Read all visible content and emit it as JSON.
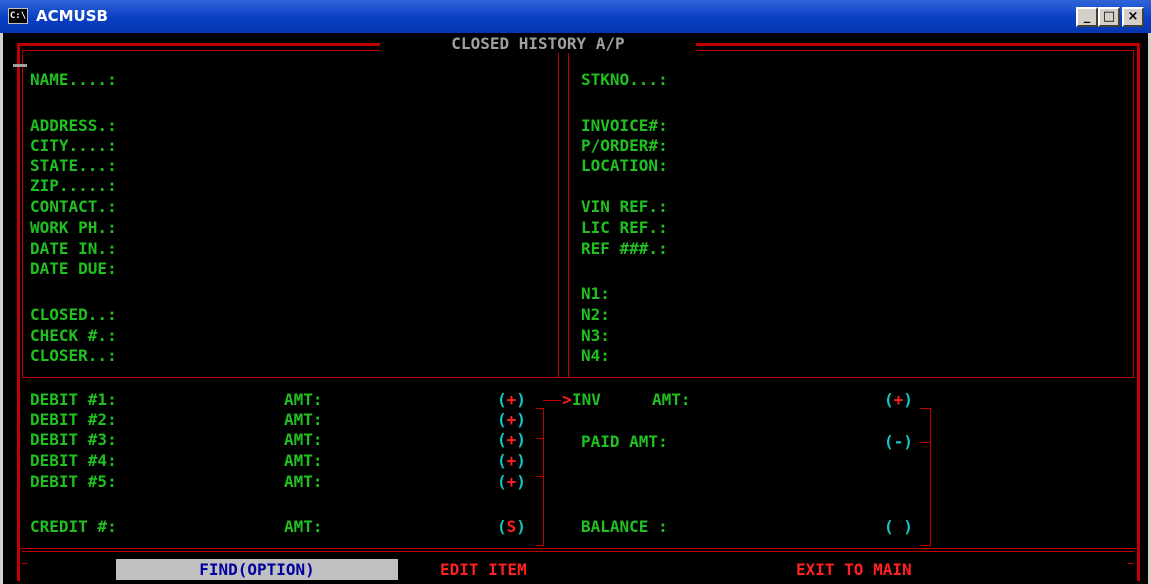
{
  "window": {
    "title": "ACMUSB",
    "icon": "C:\\",
    "buttons": {
      "minimize": "_",
      "maximize": "□",
      "close": "×"
    }
  },
  "screen": {
    "title": "CLOSED HISTORY A/P"
  },
  "left_fields": [
    "NAME....:",
    "ADDRESS.:",
    "CITY....:",
    "STATE...:",
    "ZIP.....:",
    "CONTACT.:",
    "WORK PH.:",
    "DATE IN.:",
    "DATE DUE:",
    "CLOSED..:",
    "CHECK #.:",
    "CLOSER..:"
  ],
  "right_fields": [
    "STKNO...:",
    "INVOICE#:",
    "P/ORDER#:",
    "LOCATION:",
    "VIN REF.:",
    "LIC REF.:",
    "REF ###.:",
    "N1:",
    "N2:",
    "N3:",
    "N4:"
  ],
  "debits": {
    "labels": [
      "DEBIT #1:",
      "DEBIT #2:",
      "DEBIT #3:",
      "DEBIT #4:",
      "DEBIT #5:",
      "CREDIT #:"
    ],
    "amt_label": "AMT:",
    "signs": [
      "+",
      "+",
      "+",
      "+",
      "+",
      "S"
    ]
  },
  "totals": {
    "inv": "INV",
    "inv_amt": "AMT:",
    "inv_sign": "+",
    "paid": "PAID AMT:",
    "paid_sign": "-",
    "balance": "BALANCE :",
    "balance_sign": " "
  },
  "menu": {
    "find": "FIND(OPTION)",
    "edit": "EDIT ITEM",
    "exit": "EXIT TO MAIN"
  },
  "colors": {
    "frame": "#c00000",
    "label": "#20c020",
    "accent": "#ff2020",
    "sign": "#10c8c8",
    "titlebar": "#0a3fc4"
  }
}
